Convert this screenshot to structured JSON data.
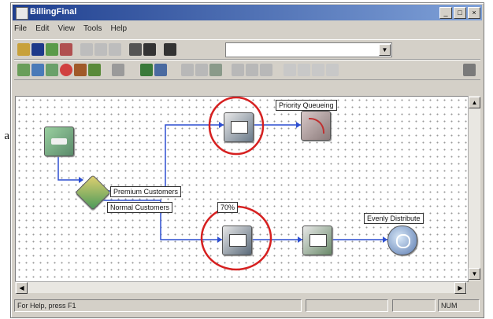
{
  "figure_caption": "a",
  "window": {
    "title": "BillingFinal",
    "buttons": {
      "minimize": "_",
      "maximize": "□",
      "close": "×"
    }
  },
  "menu": [
    "File",
    "Edit",
    "View",
    "Tools",
    "Help"
  ],
  "toolbar": {
    "search_value": "",
    "search_dropdown_arrow": "▼"
  },
  "canvas": {
    "labels": {
      "premium_customers": "Premium Customers",
      "normal_customers": "Normal Customers",
      "priority_queueing": "Priority Queueing",
      "percent": "70%",
      "evenly_distribute": "Evenly Distribute"
    },
    "highlight_color": "#d62020",
    "edge_color": "#2d4fd0"
  },
  "scroll": {
    "left_arrow": "◀",
    "right_arrow": "▶",
    "up_arrow": "▲",
    "down_arrow": "▼"
  },
  "status_bar": {
    "help_text": "For Help, press F1",
    "mode": "NUM"
  }
}
